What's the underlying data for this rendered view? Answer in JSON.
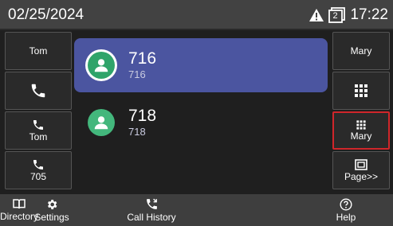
{
  "status": {
    "date": "02/25/2024",
    "time": "17:22",
    "line_number": "2",
    "icons": [
      "warning-icon",
      "line-indicator-icon"
    ]
  },
  "left_keys": [
    {
      "label": "Tom",
      "icon": ""
    },
    {
      "label": "",
      "icon": "phone-icon"
    },
    {
      "label": "Tom",
      "icon": "phone-icon"
    },
    {
      "label": "705",
      "icon": "phone-icon"
    }
  ],
  "right_keys": [
    {
      "label": "Mary",
      "icon": ""
    },
    {
      "label": "",
      "icon": "dialpad-icon"
    },
    {
      "label": "Mary",
      "icon": "dialpad-icon"
    },
    {
      "label": "Page>>",
      "icon": "page-icon"
    }
  ],
  "contacts": [
    {
      "name": "716",
      "number": "716",
      "selected": true
    },
    {
      "name": "718",
      "number": "718",
      "selected": false
    }
  ],
  "bottom_keys": [
    {
      "label": "Settings",
      "icon": "gear-icon"
    },
    {
      "label": "Call History",
      "icon": "call-history-icon"
    },
    {
      "label": "Directory",
      "icon": "book-icon"
    },
    {
      "label": "Help",
      "icon": "help-icon"
    }
  ],
  "colors": {
    "selected_row": "#4b55a0",
    "avatar": "#43b77c",
    "highlight_border": "#d0262a"
  }
}
